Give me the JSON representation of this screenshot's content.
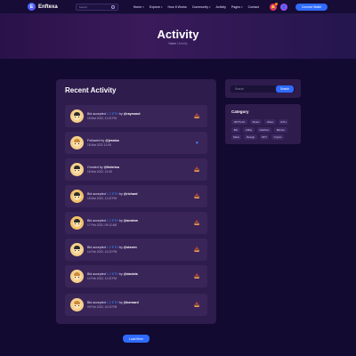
{
  "brand": {
    "name": "Enftexa",
    "logo_letter": "E"
  },
  "search": {
    "placeholder": "Search"
  },
  "nav": [
    {
      "label": "Home",
      "has_dropdown": true
    },
    {
      "label": "Explore",
      "has_dropdown": true
    },
    {
      "label": "How It Works",
      "has_dropdown": false
    },
    {
      "label": "Community",
      "has_dropdown": true
    },
    {
      "label": "Activity",
      "has_dropdown": false
    },
    {
      "label": "Pages",
      "has_dropdown": true
    },
    {
      "label": "Contact",
      "has_dropdown": false
    }
  ],
  "header": {
    "connect_label": "Connect Wallet",
    "notification_icon": "bell-icon",
    "user_icon": "user-icon"
  },
  "hero": {
    "title": "Activity",
    "breadcrumb_home": "Home",
    "breadcrumb_separator": "/",
    "breadcrumb_current": "Activity"
  },
  "activity": {
    "title": "Recent Activity",
    "items": [
      {
        "prefix": "Bid accepted ",
        "amount": "1.2 ETH",
        "by": " by ",
        "user": "@raymond",
        "time": "18 Mar 2022, 11:22 PM",
        "icon": "📥"
      },
      {
        "prefix": "Followed by ",
        "amount": "",
        "by": "",
        "user": "@jessica",
        "time": "18 Mar 2022 12:05",
        "icon": "♥"
      },
      {
        "prefix": "Created by ",
        "amount": "",
        "by": "",
        "user": "@federica",
        "time": "18 Mar 2022, 12:05",
        "icon": "📥"
      },
      {
        "prefix": "Bid accepted ",
        "amount": "1.2 ETH",
        "by": " by ",
        "user": "@richard",
        "time": "18 Mar 2022, 11:22 PM",
        "icon": "📥"
      },
      {
        "prefix": "Bid accepted ",
        "amount": "1.2 ETH",
        "by": " by ",
        "user": "@andrew",
        "time": "17 Feb 2022, 09:12 AM",
        "icon": "📥"
      },
      {
        "prefix": "Bid accepted ",
        "amount": "1.2 ETH",
        "by": " by ",
        "user": "@steven",
        "time": "14 Feb 2022, 10:22 PM",
        "icon": "📥"
      },
      {
        "prefix": "Bid accepted ",
        "amount": "1.2 ETH",
        "by": " by ",
        "user": "@daniela",
        "time": "10 Feb 2022, 11:22 PM",
        "icon": "📥"
      },
      {
        "prefix": "Bid accepted ",
        "amount": "1.2 ETH",
        "by": " by ",
        "user": "@bernard",
        "time": "09 Feb 2022, 10:22 PM",
        "icon": "📥"
      }
    ],
    "load_more": "Load More"
  },
  "sidebar": {
    "search_placeholder": "Search",
    "search_button": "Search",
    "category_title": "Category",
    "tags": [
      "NFTS Art",
      "Music",
      "Video",
      "ETH",
      "Btc",
      "Utility",
      "Fashion",
      "Bitcoin",
      "Meta",
      "Design",
      "NFT",
      "Crypto"
    ]
  }
}
